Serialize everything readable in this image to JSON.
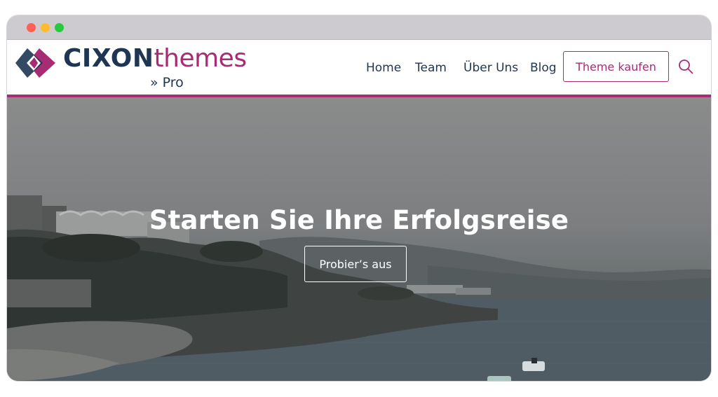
{
  "brand": {
    "name_bold": "CIXON",
    "name_light": "themes",
    "tagline": "» Pro",
    "primary_color": "#a82c74",
    "dark_color": "#1e3553"
  },
  "nav": {
    "items": [
      {
        "label": "Home"
      },
      {
        "label": "Team"
      },
      {
        "label": "Über Uns"
      },
      {
        "label": "Blog"
      }
    ],
    "cta_label": "Theme kaufen",
    "search_icon": "search-icon"
  },
  "hero": {
    "title": "Starten Sie Ihre Erfolgsreise",
    "button_label": "Probier’s aus"
  }
}
